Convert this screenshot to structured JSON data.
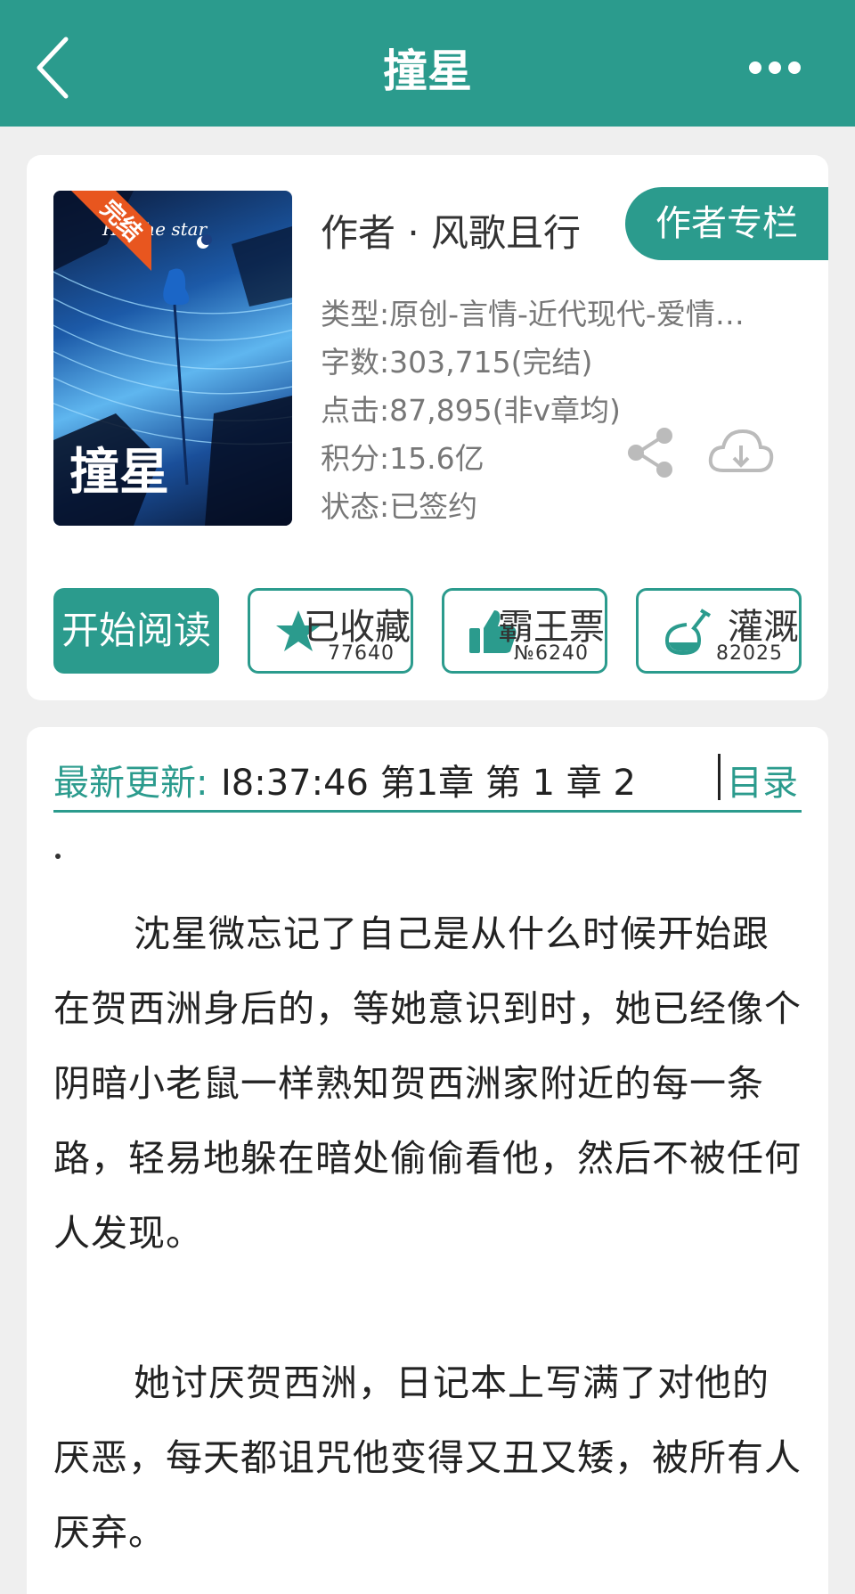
{
  "header": {
    "title": "撞星"
  },
  "book": {
    "cover_text": "Hit the star",
    "cover_badge": "完结",
    "author": "作者 · 风歌且行",
    "author_column_btn": "作者专栏",
    "type": "类型:原创-言情-近代现代-爱情…",
    "words": "字数:303,715(完结)",
    "clicks": "点击:87,895(非v章均)",
    "score": "积分:15.6亿",
    "status": "状态:已签约"
  },
  "actions": {
    "start": "开始阅读",
    "collect": {
      "label": "已收藏",
      "count": "77640",
      "icon": "star-icon"
    },
    "ticket": {
      "label": "霸王票",
      "count": "№6240",
      "icon": "thumb-up-icon"
    },
    "water": {
      "label": "灌溉",
      "count": "82025",
      "icon": "watering-flask-icon"
    }
  },
  "update": {
    "label": "最新更新:",
    "value": "I8:37:46   第1章 第 1 章 2(",
    "toc": "目录"
  },
  "content": {
    "p1": "沈星微忘记了自己是从什么时候开始跟在贺西洲身后的，等她意识到时，她已经像个阴暗小老鼠一样熟知贺西洲家附近的每一条路，轻易地躲在暗处偷偷看他，然后不被任何人发现。",
    "p2": "她讨厌贺西洲，日记本上写满了对他的厌恶，每天都诅咒他变得又丑又矮，被所有人厌弃。"
  },
  "colors": {
    "accent": "#2b9b8d",
    "badge": "#e8561f"
  }
}
